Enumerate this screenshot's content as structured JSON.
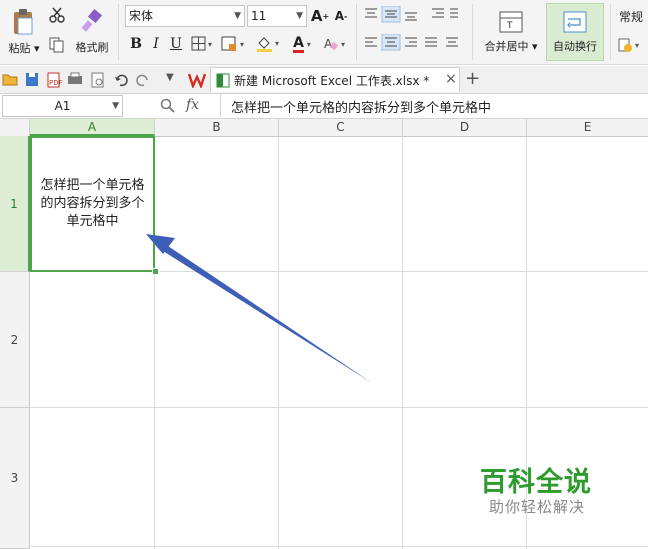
{
  "ribbon": {
    "paste_label": "粘贴",
    "format_painter_label": "格式刷",
    "font_name": "宋体",
    "font_size": "11",
    "bold": "B",
    "italic": "I",
    "underline": "U",
    "merge_center_label": "合并居中",
    "wrap_text_label": "自动换行",
    "number_format": "常规",
    "font_grow": "A",
    "font_shrink": "A",
    "font_color_glyph": "A"
  },
  "toolbar": {
    "tab_title": "新建 Microsoft Excel 工作表.xlsx *",
    "tab_close": "×",
    "new_tab": "+"
  },
  "formula_bar": {
    "name_box": "A1",
    "fx_label": "fx",
    "content": "怎样把一个单元格的内容拆分到多个单元格中"
  },
  "grid": {
    "columns": [
      "A",
      "B",
      "C",
      "D",
      "E"
    ],
    "rows": [
      "1",
      "2",
      "3"
    ],
    "cell_a1": "怎样把一个单元格的内容拆分到多个单元格中"
  },
  "watermark": {
    "brand": "百科全说",
    "slogan": "助你轻松解决"
  },
  "colors": {
    "selection": "#4da44d",
    "arrow": "#3d5fb8",
    "brand": "#2d9b2d"
  }
}
